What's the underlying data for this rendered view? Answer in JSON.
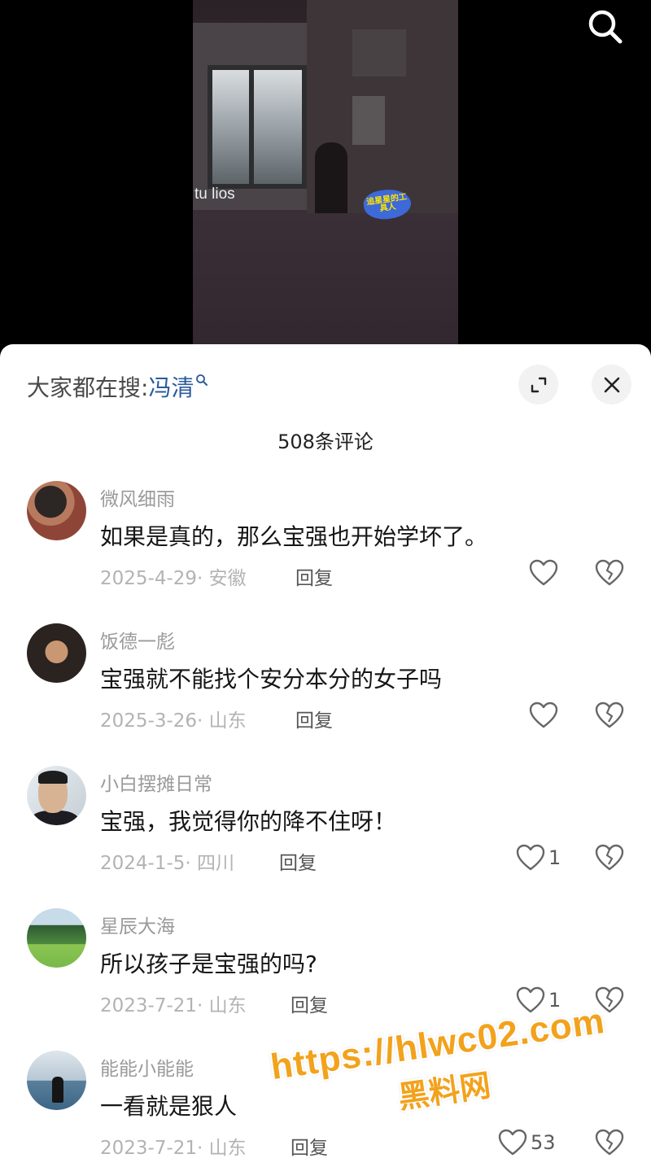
{
  "video": {
    "overlay_text": "tu lios",
    "sticker_text": "追星星的工具人"
  },
  "top_bar": {
    "search_icon": "search-icon"
  },
  "sheet": {
    "search_hint_prefix": "大家都在搜:",
    "search_hint_term": "冯清",
    "comment_count_label": "508条评论",
    "expand_icon": "expand-icon",
    "close_icon": "close-icon"
  },
  "comments": [
    {
      "user": "微风细雨",
      "text": "如果是真的，那么宝强也开始学坏了。",
      "date_location": "2025-4-29· 安徽",
      "reply_label": "回复",
      "likes": ""
    },
    {
      "user": "饭德一彪",
      "text": "宝强就不能找个安分本分的女子吗",
      "date_location": "2025-3-26· 山东",
      "reply_label": "回复",
      "likes": ""
    },
    {
      "user": "小白摆摊日常",
      "text": "宝强，我觉得你的降不住呀！",
      "date_location": "2024-1-5· 四川",
      "reply_label": "回复",
      "likes": "1"
    },
    {
      "user": "星辰大海",
      "text": "所以孩子是宝强的吗?",
      "date_location": "2023-7-21· 山东",
      "reply_label": "回复",
      "likes": "1"
    },
    {
      "user": "能能小能能",
      "text": "一看就是狠人",
      "date_location": "2023-7-21· 山东",
      "reply_label": "回复",
      "likes": "53"
    }
  ],
  "watermark": {
    "url": "https://hlwc02.com",
    "label": "黑料网"
  }
}
